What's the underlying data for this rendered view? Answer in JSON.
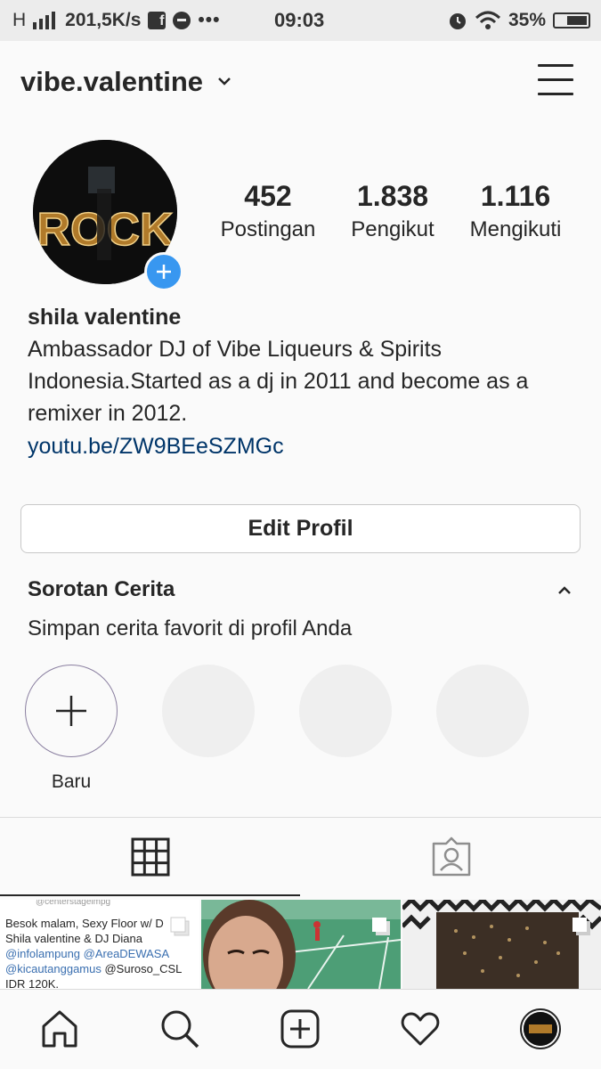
{
  "status_bar": {
    "signal": "H",
    "net_speed": "201,5K/s",
    "time": "09:03",
    "battery": "35%"
  },
  "header": {
    "username": "vibe.valentine"
  },
  "profile": {
    "avatar_text": "ROCK",
    "stats": [
      {
        "value": "452",
        "label": "Postingan"
      },
      {
        "value": "1.838",
        "label": "Pengikut"
      },
      {
        "value": "1.116",
        "label": "Mengikuti"
      }
    ],
    "full_name": "shila valentine",
    "bio": "Ambassador DJ  of Vibe Liqueurs & Spirits\nIndonesia.Started as a dj in 2011 and become as a\nremixer in 2012.",
    "link": "youtu.be/ZW9BEeSZMGc",
    "edit_button": "Edit Profil"
  },
  "highlights": {
    "title": "Sorotan Cerita",
    "subtitle": "Simpan cerita favorit di profil Anda",
    "new_label": "Baru"
  },
  "posts": {
    "post1": {
      "top": "@centerstagelmpg",
      "line1": "Besok malam, Sexy Floor w/ D",
      "line2": "Shila valentine & DJ Diana",
      "line3": "@infolampung @AreaDEWASA",
      "line4a": "@kicautanggamus",
      "line4b": " @Suroso_CSL",
      "line5": "IDR 120K."
    }
  },
  "colors": {
    "accent": "#3897f0",
    "link": "#003569",
    "text": "#262626",
    "border": "#dbdbdb"
  }
}
